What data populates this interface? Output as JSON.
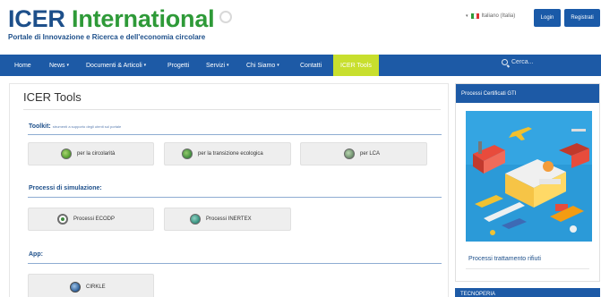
{
  "header": {
    "brand_word1": "ICER",
    "brand_word2": "International",
    "tagline": "Portale di Innovazione e Ricerca e dell'economia circolare",
    "language": "Italiano (Italia)",
    "login_label": "Login",
    "register_label": "Registrati"
  },
  "nav": {
    "items": [
      {
        "label": "Home",
        "caret": ""
      },
      {
        "label": "News",
        "caret": "▾"
      },
      {
        "label": "Documenti & Articoli",
        "caret": "▾"
      },
      {
        "label": "Progetti",
        "caret": ""
      },
      {
        "label": "Servizi",
        "caret": "▾"
      },
      {
        "label": "Chi Siamo",
        "caret": "▾"
      },
      {
        "label": "Contatti",
        "caret": ""
      },
      {
        "label": "ICER Tools",
        "caret": ""
      }
    ],
    "active_index": 7,
    "search_placeholder": "Cerca..."
  },
  "main": {
    "title": "ICER Tools",
    "sections": [
      {
        "label": "Toolkit:",
        "sublabel": "strumenti a supporto degli utenti sul portale",
        "buttons": [
          {
            "label": "per la circolarità",
            "icon": "circularity-globe-icon"
          },
          {
            "label": "per la transizione ecologica",
            "icon": "ecological-transition-globe-icon"
          },
          {
            "label": "per LCA",
            "icon": "lca-globe-icon"
          }
        ]
      },
      {
        "label": "Processi di simulazione:",
        "sublabel": "",
        "buttons": [
          {
            "label": "Processi ECODP",
            "icon": "ecodp-process-icon"
          },
          {
            "label": "Processi INERTEX",
            "icon": "inertex-process-icon"
          }
        ]
      },
      {
        "label": "App:",
        "sublabel": "",
        "buttons": [
          {
            "label": "CIRKLE",
            "icon": "cirkle-app-icon"
          }
        ]
      }
    ]
  },
  "sidebar": {
    "card1_title": "Processi Certificati GTI",
    "card1_caption": "Processi trattamento rifiuti",
    "card2_title": "TECNOPERIA"
  },
  "colors": {
    "brand_blue": "#1d4f8a",
    "brand_green": "#2e9a38",
    "nav_blue": "#1d5aa6",
    "nav_active": "#c8df2e",
    "button_grey": "#eeeeee"
  }
}
